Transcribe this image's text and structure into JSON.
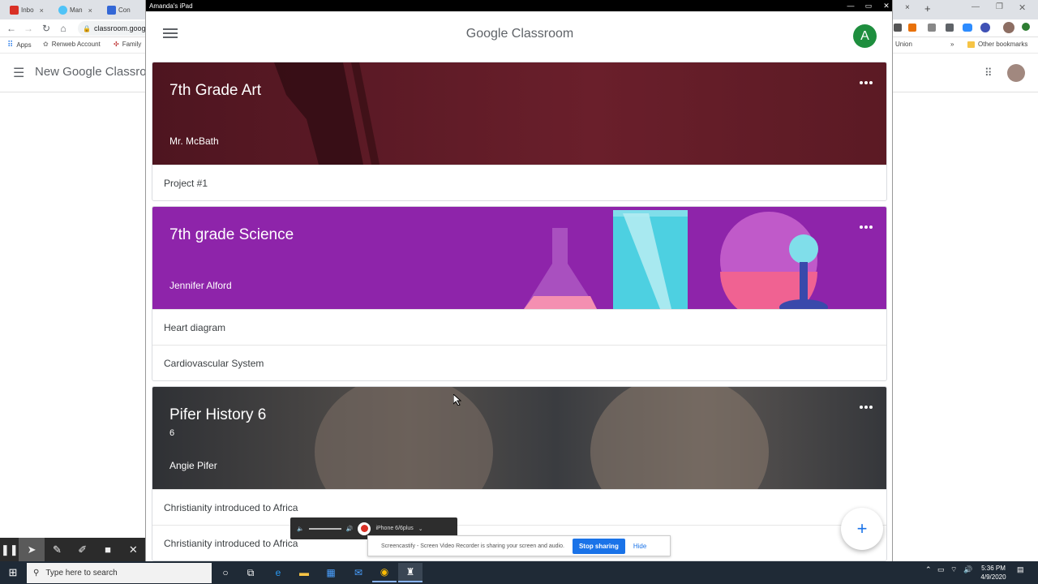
{
  "chrome": {
    "tabs": [
      {
        "label": "Inbo",
        "color": "#d93025"
      },
      {
        "label": "Man",
        "color": "#4fc3f7"
      },
      {
        "label": "Con",
        "color": "#3367d6"
      }
    ],
    "omnibox": "classroom.goog",
    "bookmarks": [
      "Apps",
      "Renweb Account",
      "Family"
    ],
    "bookmarks_right": [
      "Union",
      "Other bookmarks"
    ],
    "page_title": "New Google Classro"
  },
  "ipad": {
    "window_title": "Amanda's iPad",
    "header_title": "Google Classroom",
    "avatar_letter": "A",
    "classes": [
      {
        "title": "7th Grade Art",
        "section": "",
        "teacher": "Mr. McBath",
        "color": "#5b1a24",
        "assignments": [
          "Project #1"
        ]
      },
      {
        "title": "7th grade Science",
        "section": "",
        "teacher": "Jennifer Alford",
        "color": "#8e24aa",
        "assignments": [
          "Heart diagram",
          "Cardiovascular System"
        ]
      },
      {
        "title": "Pifer History 6",
        "section": "6",
        "teacher": "Angie Pifer",
        "color": "#3d3f43",
        "assignments": [
          "Christianity introduced to Africa",
          "Christianity introduced to Africa"
        ]
      }
    ],
    "fab_label": "+"
  },
  "recorder": {
    "device": "iPhone 6/6plus"
  },
  "share_notice": {
    "text": "Screencastify - Screen Video Recorder is sharing your screen and audio.",
    "stop_label": "Stop sharing",
    "hide_label": "Hide"
  },
  "taskbar": {
    "search_placeholder": "Type here to search",
    "time": "5:36 PM",
    "date": "4/9/2020"
  }
}
